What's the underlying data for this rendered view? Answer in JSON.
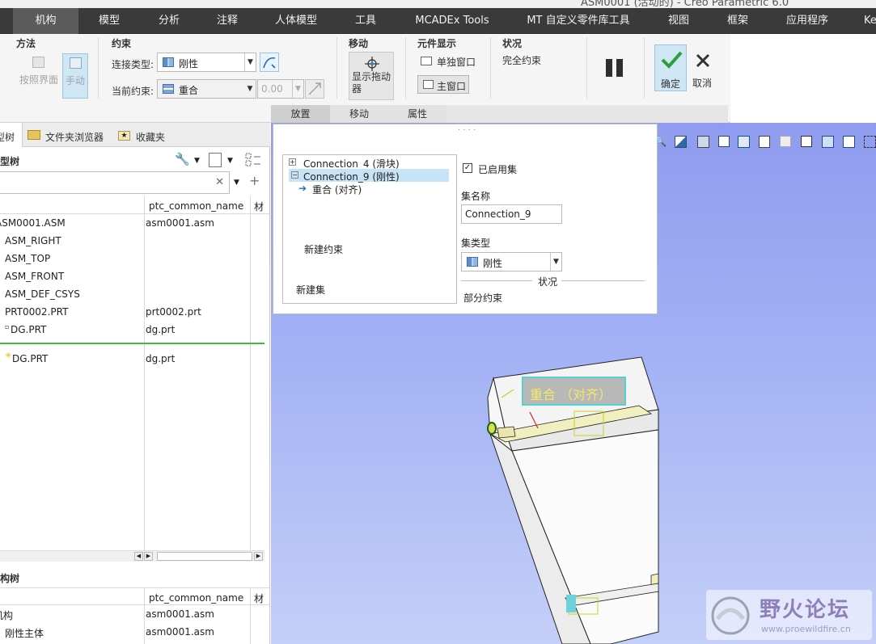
{
  "window": {
    "title": "ASM0001 (活动的) - Creo Parametric 6.0"
  },
  "menu": {
    "tabs": [
      {
        "label": "机构",
        "active": true
      },
      {
        "label": "模型"
      },
      {
        "label": "分析"
      },
      {
        "label": "注释"
      },
      {
        "label": "人体模型"
      },
      {
        "label": "工具"
      },
      {
        "label": "MCADEx Tools"
      },
      {
        "label": "MT 自定义零件库工具"
      },
      {
        "label": "视图"
      },
      {
        "label": "框架"
      },
      {
        "label": "应用程序"
      },
      {
        "label": "Ke"
      }
    ]
  },
  "ribbon": {
    "method": {
      "title": "方法",
      "ref_ui": "按照界面",
      "manual": "手动"
    },
    "constraint": {
      "title": "约束",
      "connection_type_label": "连接类型:",
      "connection_type_value": "刚性",
      "current_constraint_label": "当前约束:",
      "current_constraint_value": "重合",
      "offset_value": "0.00"
    },
    "move": {
      "title": "移动",
      "show_drag": "显示拖动器"
    },
    "display": {
      "title": "元件显示",
      "separate_window": "单独窗口",
      "main_window": "主窗口"
    },
    "status": {
      "title": "状况",
      "value": "完全约束"
    },
    "ok": "确定",
    "cancel": "取消",
    "subtabs": [
      "放置",
      "移动",
      "属性"
    ]
  },
  "left_panel": {
    "tabs": [
      "模型树",
      "文件夹浏览器",
      "收藏夹"
    ],
    "model_tree_title": "模型树",
    "column_name": "ptc_common_name",
    "column_material": "材",
    "rows": [
      {
        "name": "ASM0001.ASM",
        "common": "asm0001.asm"
      },
      {
        "name": "ASM_RIGHT",
        "common": ""
      },
      {
        "name": "ASM_TOP",
        "common": ""
      },
      {
        "name": "ASM_FRONT",
        "common": ""
      },
      {
        "name": "ASM_DEF_CSYS",
        "common": ""
      },
      {
        "name": "PRT0002.PRT",
        "common": "prt0002.prt"
      },
      {
        "name": "DG.PRT",
        "common": "dg.prt"
      },
      {
        "name": "DG.PRT",
        "common": "dg.prt"
      }
    ],
    "lower_title": "机构树",
    "lower_rows": [
      {
        "name": "机构",
        "common": "asm0001.asm"
      },
      {
        "name": "刚性主体",
        "common": "asm0001.asm"
      }
    ]
  },
  "placement": {
    "tree": [
      {
        "label": "Connection_4 (滑块)"
      },
      {
        "label": "Connection_9 (刚性)"
      },
      {
        "label": "重合 (对齐)"
      }
    ],
    "new_constraint": "新建约束",
    "new_set": "新建集",
    "enable_set": "已启用集",
    "set_name_label": "集名称",
    "set_name_value": "Connection_9",
    "set_type_label": "集类型",
    "set_type_value": "刚性",
    "status_label": "状况",
    "status_value": "部分约束"
  },
  "viewport": {
    "constraint_tag": "重合 （对齐）",
    "watermark_title": "野火论坛",
    "watermark_url": "www.proewildfire.cn"
  },
  "colors": {
    "menubar": "#3a3a3a",
    "accent_blue": "#1f86c8",
    "selection": "#c6e3f7",
    "viewport_top": "#8f9cf0",
    "viewport_bottom": "#c4cff8",
    "ok_green": "#2e9d3a"
  }
}
